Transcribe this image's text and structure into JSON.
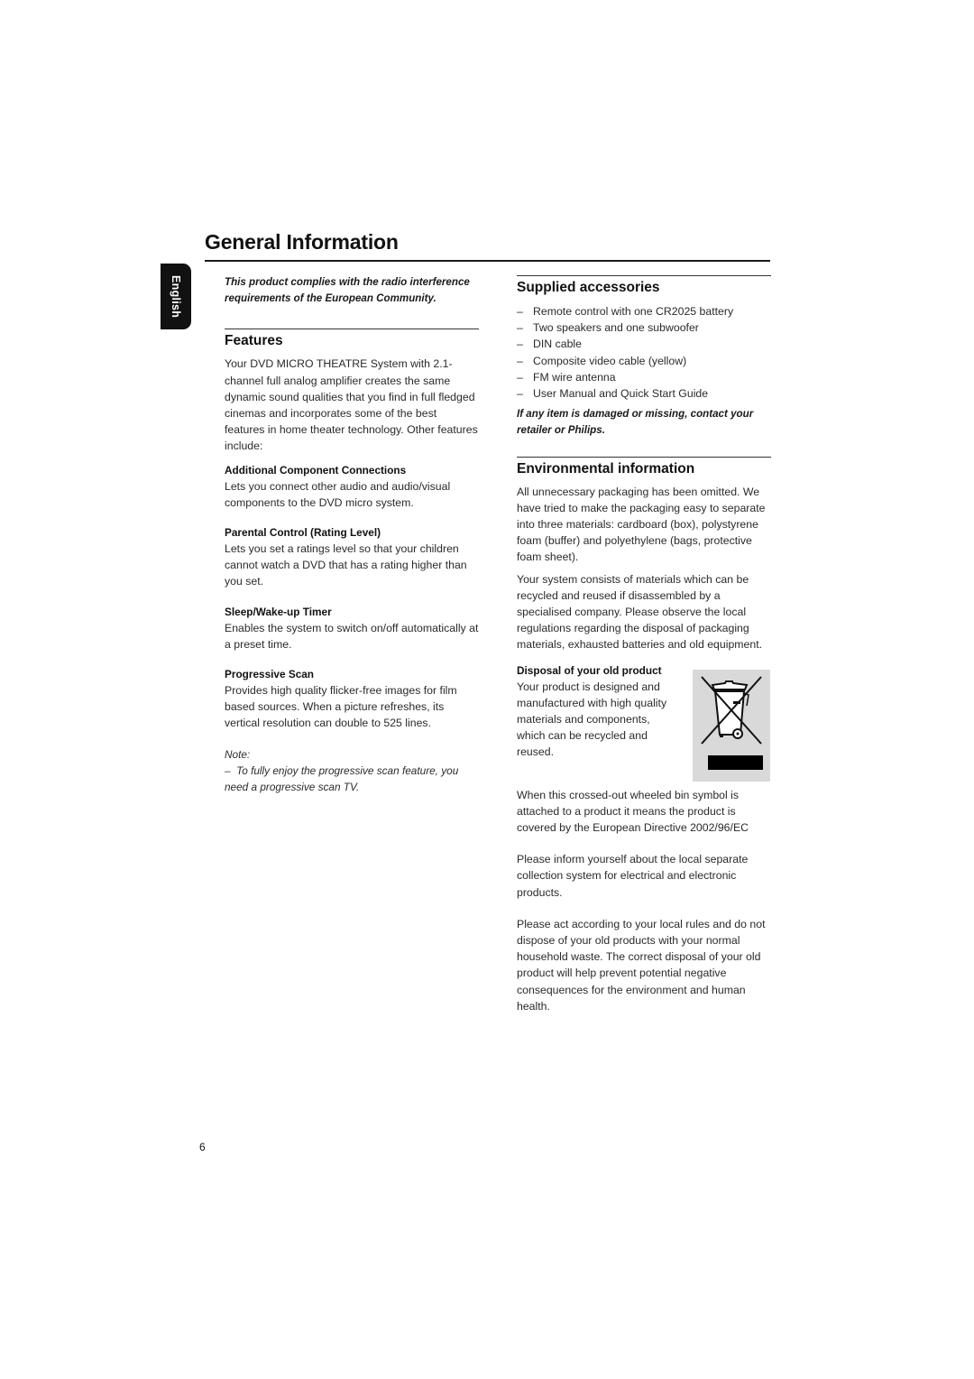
{
  "page": {
    "title": "General Information",
    "language_tab": "English",
    "page_number": "6"
  },
  "left": {
    "compliance": "This product complies with the radio interference requirements of the European Community.",
    "features": {
      "heading": "Features",
      "intro": "Your DVD MICRO THEATRE System  with 2.1-channel full analog amplifier creates the same dynamic sound qualities that you find in full fledged cinemas and incorporates some of the best features in home theater technology. Other features include:",
      "items": [
        {
          "title": "Additional Component Connections",
          "body": "Lets you connect other audio and audio/visual components to the DVD micro system."
        },
        {
          "title": "Parental Control (Rating Level)",
          "body": "Lets you set a ratings level so that your children cannot watch a DVD that has a rating higher than you set."
        },
        {
          "title": "Sleep/Wake-up Timer",
          "body": "Enables the system to switch on/off automatically at a preset time."
        },
        {
          "title": "Progressive Scan",
          "body": "Provides high quality flicker-free images for film based sources. When a picture refreshes, its vertical resolution can double to 525 lines."
        }
      ],
      "note_label": "Note:",
      "note_dash": "–",
      "note_text": "To fully enjoy the progressive scan feature, you need a progressive scan TV."
    }
  },
  "right": {
    "accessories": {
      "heading": "Supplied accessories",
      "dash": "–",
      "items": [
        "Remote control with one CR2025 battery",
        "Two speakers and one subwoofer",
        "DIN cable",
        "Composite video cable (yellow)",
        "FM wire antenna",
        "User Manual and Quick Start Guide"
      ],
      "warning": "If any item is damaged or missing, contact your retailer or Philips."
    },
    "environment": {
      "heading": "Environmental information",
      "p1": "All unnecessary packaging has been omitted. We have tried to make the packaging easy to separate into three materials: cardboard (box), polystyrene foam (buffer) and polyethylene (bags, protective foam sheet).",
      "p2": "Your system consists of materials which can be recycled and reused if disassembled by a specialised company. Please observe the local regulations regarding the disposal of packaging materials, exhausted batteries and old equipment.",
      "disposal_title": "Disposal of  your old product",
      "disposal_body": "Your product is designed and manufactured with high quality materials and components, which can be recycled and reused.",
      "bin_icon": "crossed-out-wheeled-bin-icon",
      "p3": "When this crossed-out wheeled bin symbol is attached to a product it means the product is covered by the European Directive 2002/96/EC",
      "p4": "Please inform yourself about the local separate collection system for electrical and electronic products.",
      "p5": "Please act according to your local rules and do not dispose of your old products with your normal household waste. The correct disposal of your old product will help prevent potential negative consequences for the environment and human health."
    }
  }
}
